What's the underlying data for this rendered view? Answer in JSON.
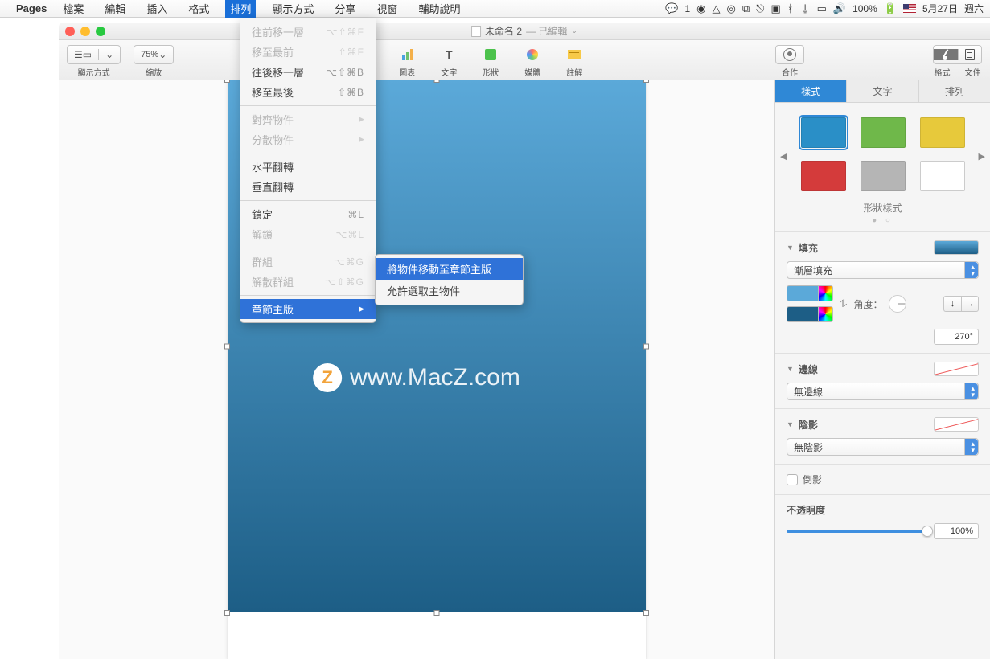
{
  "menubar": {
    "app": "Pages",
    "items": [
      "檔案",
      "編輯",
      "插入",
      "格式",
      "排列",
      "顯示方式",
      "分享",
      "視窗",
      "輔助說明"
    ],
    "active_index": 4,
    "right": {
      "wechat": "1",
      "battery": "100%",
      "date": "5月27日",
      "day": "週六"
    }
  },
  "window": {
    "title": "未命名 2",
    "edited": "— 已編輯"
  },
  "toolbar": {
    "view": "顯示方式",
    "zoom_label": "縮放",
    "zoom_value": "75%",
    "chart": "圖表",
    "text": "文字",
    "shape": "形狀",
    "media": "媒體",
    "comment": "註解",
    "collab": "合作",
    "format": "格式",
    "document": "文件"
  },
  "dropdown": {
    "groups": [
      [
        {
          "label": "往前移一層",
          "shortcut": "⌥⇧⌘F",
          "disabled": true
        },
        {
          "label": "移至最前",
          "shortcut": "⇧⌘F",
          "disabled": true
        },
        {
          "label": "往後移一層",
          "shortcut": "⌥⇧⌘B",
          "disabled": false
        },
        {
          "label": "移至最後",
          "shortcut": "⇧⌘B",
          "disabled": false
        }
      ],
      [
        {
          "label": "對齊物件",
          "submenu": true,
          "disabled": true
        },
        {
          "label": "分散物件",
          "submenu": true,
          "disabled": true
        }
      ],
      [
        {
          "label": "水平翻轉"
        },
        {
          "label": "垂直翻轉"
        }
      ],
      [
        {
          "label": "鎖定",
          "shortcut": "⌘L"
        },
        {
          "label": "解鎖",
          "shortcut": "⌥⌘L",
          "disabled": true
        }
      ],
      [
        {
          "label": "群組",
          "shortcut": "⌥⌘G",
          "disabled": true
        },
        {
          "label": "解散群組",
          "shortcut": "⌥⇧⌘G",
          "disabled": true
        }
      ],
      [
        {
          "label": "章節主版",
          "submenu": true,
          "highlight": true
        }
      ]
    ],
    "submenu": [
      {
        "label": "將物件移動至章節主版",
        "highlight": true
      },
      {
        "label": "允許選取主物件"
      }
    ]
  },
  "inspector": {
    "tabs": [
      "樣式",
      "文字",
      "排列"
    ],
    "active_tab": 0,
    "styles": {
      "caption": "形狀樣式",
      "swatches": [
        "#2a8fc7",
        "#6fb84a",
        "#e7c93b",
        "#d43b3b",
        "#b5b5b5",
        "#ffffff"
      ],
      "selected": 0
    },
    "fill": {
      "header": "填充",
      "type": "漸層填充",
      "color1": "#5ba9d9",
      "color2": "#1d5e86",
      "angle_label": "角度：",
      "angle_value": "270°"
    },
    "border": {
      "header": "邊線",
      "type": "無邊線"
    },
    "shadow": {
      "header": "陰影",
      "type": "無陰影"
    },
    "reflection": {
      "label": "倒影",
      "checked": false
    },
    "opacity": {
      "label": "不透明度",
      "value": "100%"
    }
  },
  "watermark": "www.MacZ.com"
}
